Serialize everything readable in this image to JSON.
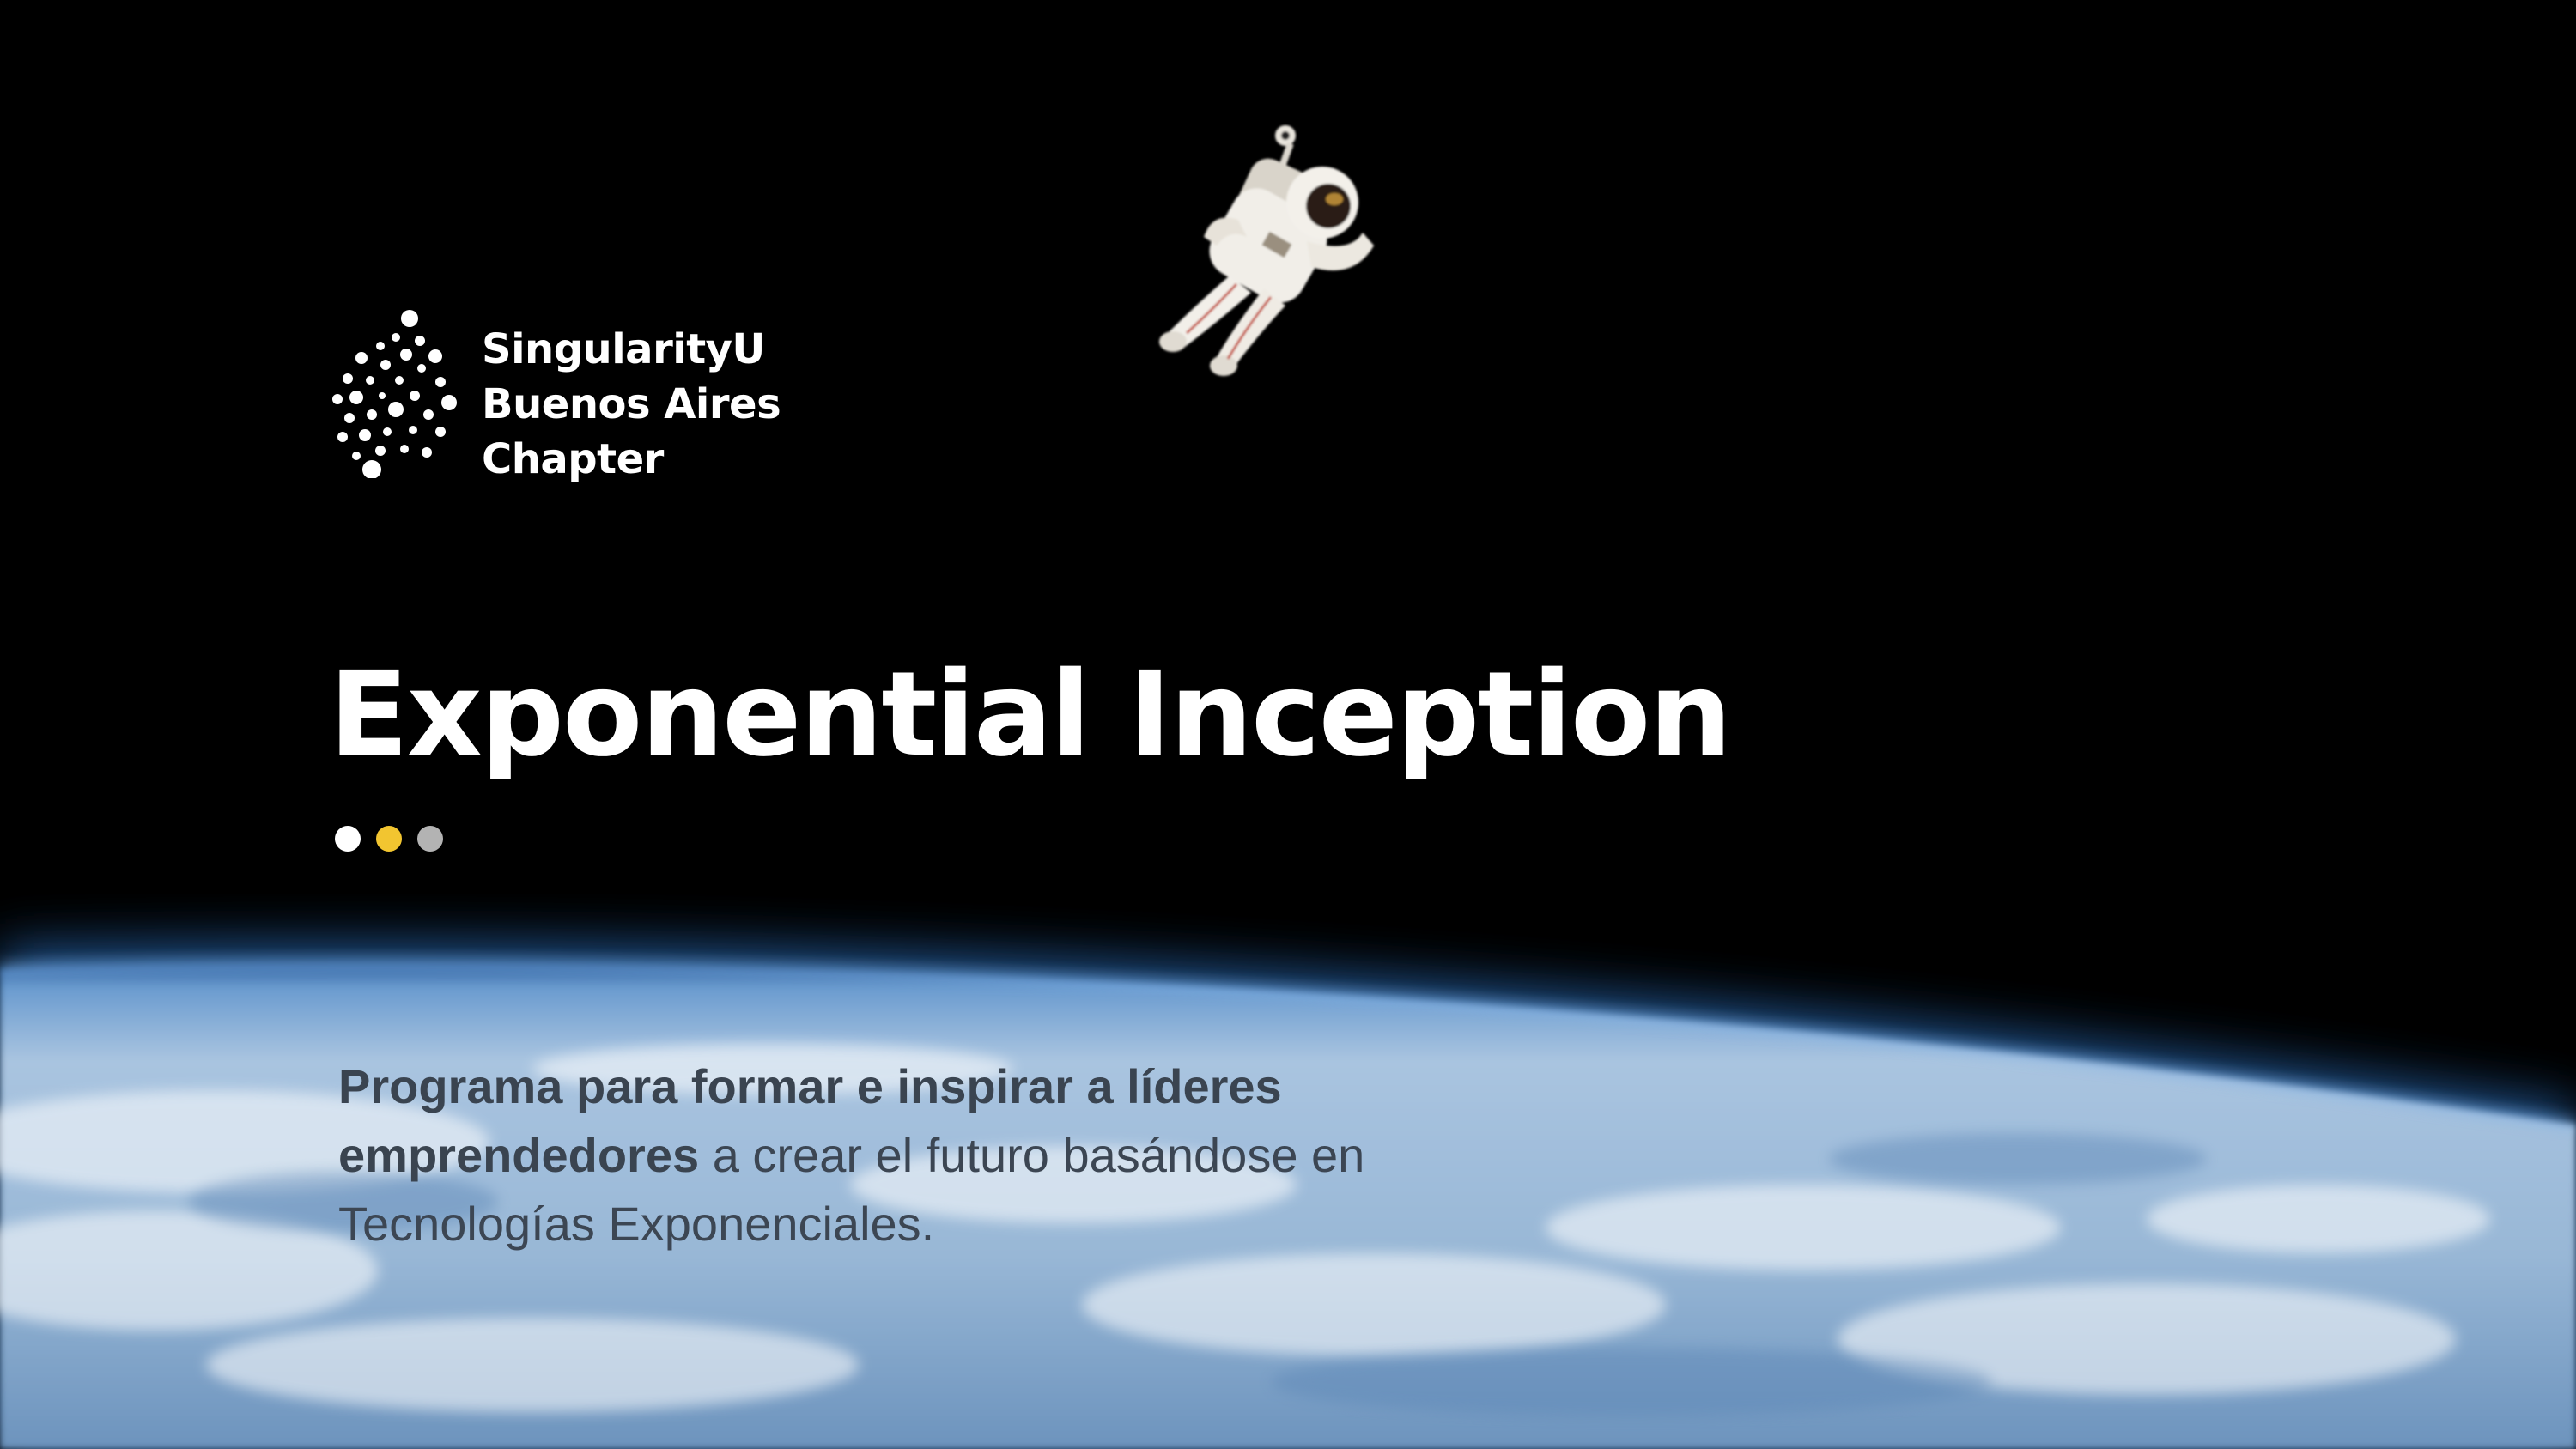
{
  "brand": {
    "logo_lines": [
      "SingularityU",
      "Buenos Aires",
      "Chapter"
    ]
  },
  "hero": {
    "title": "Exponential Inception"
  },
  "indicator_dots": [
    {
      "color": "#ffffff"
    },
    {
      "color": "#f2c530"
    },
    {
      "color": "#b3b3b3"
    }
  ],
  "description": {
    "bold_text": "Programa para formar e inspirar a líderes emprendedores",
    "rest_text": " a crear el futuro basándose en Tecnologías Exponenciales."
  },
  "colors": {
    "background": "#000000",
    "text_light": "#ffffff",
    "text_dark": "#3c4653",
    "accent_yellow": "#f2c530"
  },
  "images": {
    "astronaut": "astronaut-illustration",
    "earth": "earth-horizon-illustration"
  }
}
